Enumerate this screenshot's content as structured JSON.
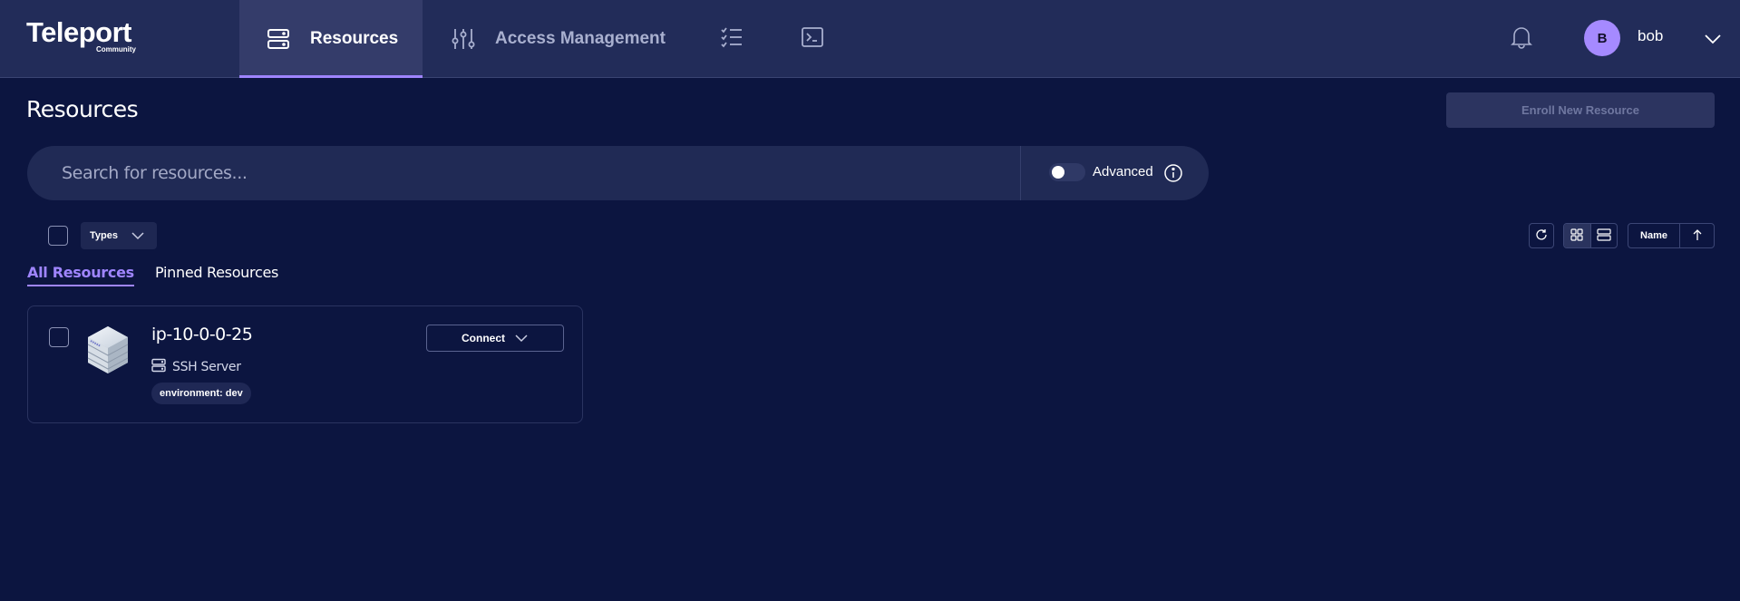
{
  "header": {
    "logo": {
      "name": "Teleport",
      "edition": "Community"
    },
    "nav": [
      {
        "label": "Resources",
        "icon": "server-icon",
        "active": true
      },
      {
        "label": "Access Management",
        "icon": "sliders-icon",
        "active": false
      }
    ],
    "icon_nav": [
      {
        "icon": "checklist-icon"
      },
      {
        "icon": "terminal-icon"
      }
    ],
    "notifications_icon": "bell-icon",
    "user": {
      "avatar_initial": "B",
      "username": "bob"
    }
  },
  "page": {
    "title": "Resources",
    "enroll_button": "Enroll New Resource",
    "search": {
      "placeholder": "Search for resources...",
      "value": ""
    },
    "advanced": {
      "label": "Advanced",
      "enabled": false
    },
    "filters": {
      "types_label": "Types"
    },
    "tabs": [
      {
        "label": "All Resources",
        "active": true
      },
      {
        "label": "Pinned Resources",
        "active": false
      }
    ],
    "toolbar": {
      "view_mode": "card",
      "sort_field": "Name",
      "sort_direction": "ascending"
    }
  },
  "resources": [
    {
      "name": "ip-10-0-0-25",
      "kind": "SSH Server",
      "labels": [
        "environment: dev"
      ],
      "action": "Connect",
      "selected": false
    }
  ],
  "colors": {
    "accent": "#9f85ff",
    "header_bg": "#222c59",
    "page_bg": "#0c1540",
    "avatar_bg": "#a58aff"
  }
}
